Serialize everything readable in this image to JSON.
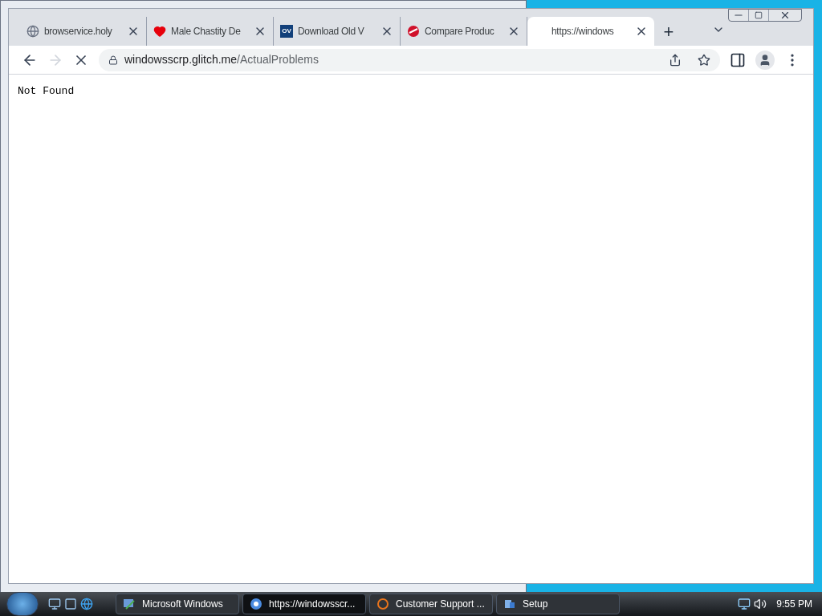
{
  "browser": {
    "tabs": [
      {
        "title": "browservice.holy",
        "kind": "globe",
        "selected": false
      },
      {
        "title": "Male Chastity De",
        "kind": "heart",
        "selected": false
      },
      {
        "title": "Download Old V",
        "kind": "badge",
        "selected": false,
        "badge": "OV"
      },
      {
        "title": "Compare Produc",
        "kind": "logo",
        "selected": false
      },
      {
        "title": "https://windows",
        "kind": "blank",
        "selected": true
      }
    ],
    "new_tab": "+",
    "address": {
      "host": "windowsscrp.glitch.me",
      "path": "/ActualProblems"
    },
    "loading": true,
    "page_text": "Not Found"
  },
  "taskbar": {
    "items": [
      {
        "label": "Microsoft Windows",
        "kind": "app",
        "selected": false
      },
      {
        "label": "https://windowsscr...",
        "kind": "chrome",
        "selected": true
      },
      {
        "label": "Customer Support ...",
        "kind": "firefox",
        "selected": false
      },
      {
        "label": "Setup",
        "kind": "setup",
        "selected": false
      }
    ],
    "clock": "9:55 PM"
  }
}
